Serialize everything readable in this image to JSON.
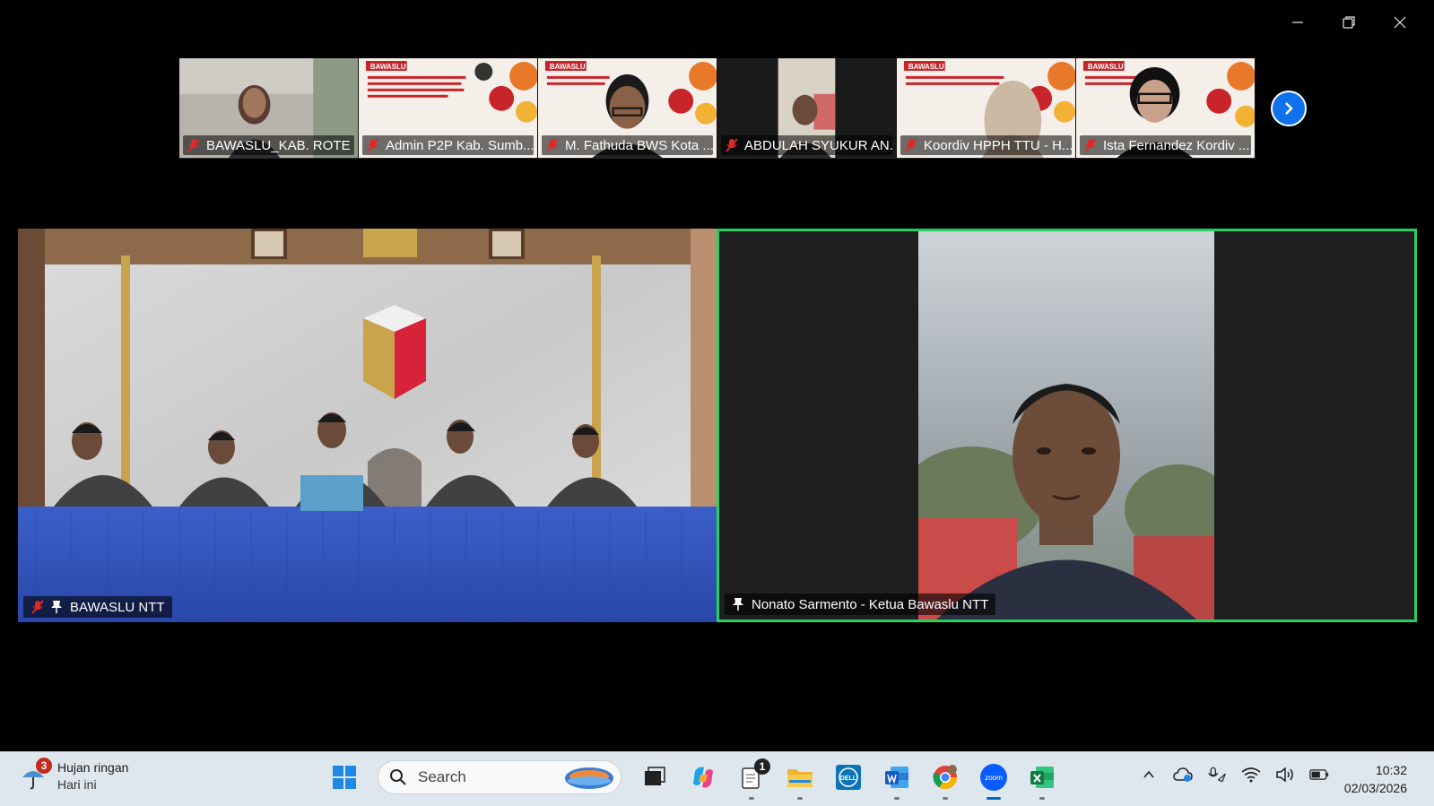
{
  "window": {
    "controls": [
      "minimize",
      "restore",
      "close"
    ]
  },
  "participants_strip": [
    {
      "name": "BAWASLU_KAB. ROTE ...",
      "muted": true
    },
    {
      "name": "Admin P2P Kab. Sumb...",
      "muted": true
    },
    {
      "name": "M. Fathuda BWS Kota ...",
      "muted": true
    },
    {
      "name": "ABDULAH SYUKUR AN...",
      "muted": true
    },
    {
      "name": "Koordiv HPPH TTU - H...",
      "muted": true
    },
    {
      "name": "Ista Fernandez Kordiv ...",
      "muted": true
    }
  ],
  "thumb_banner_text": "BAWASLU",
  "main_videos": {
    "left": {
      "name": "BAWASLU NTT",
      "muted": true,
      "pinned": true
    },
    "right": {
      "name": "Nonato Sarmento - Ketua Bawaslu NTT",
      "muted": false,
      "pinned": true,
      "active_speaker": true
    }
  },
  "colors": {
    "active_speaker_border": "#23d160",
    "next_button": "#0e72ed",
    "taskbar": "#dfe7ee"
  },
  "taskbar": {
    "weather": {
      "badge": "3",
      "title": "Hujan ringan",
      "subtitle": "Hari ini"
    },
    "search_placeholder": "Search",
    "notification_badge": "1",
    "apps": [
      "start-icon",
      "search",
      "task-view-icon",
      "copilot-icon",
      "notepad-icon",
      "file-explorer-icon",
      "dell-icon",
      "word-icon",
      "chrome-icon",
      "zoom-icon",
      "excel-icon"
    ],
    "dell_label": "DELL",
    "zoom_label": "zoom",
    "clock": {
      "time": "10:32",
      "date": "02/03/2026"
    }
  }
}
